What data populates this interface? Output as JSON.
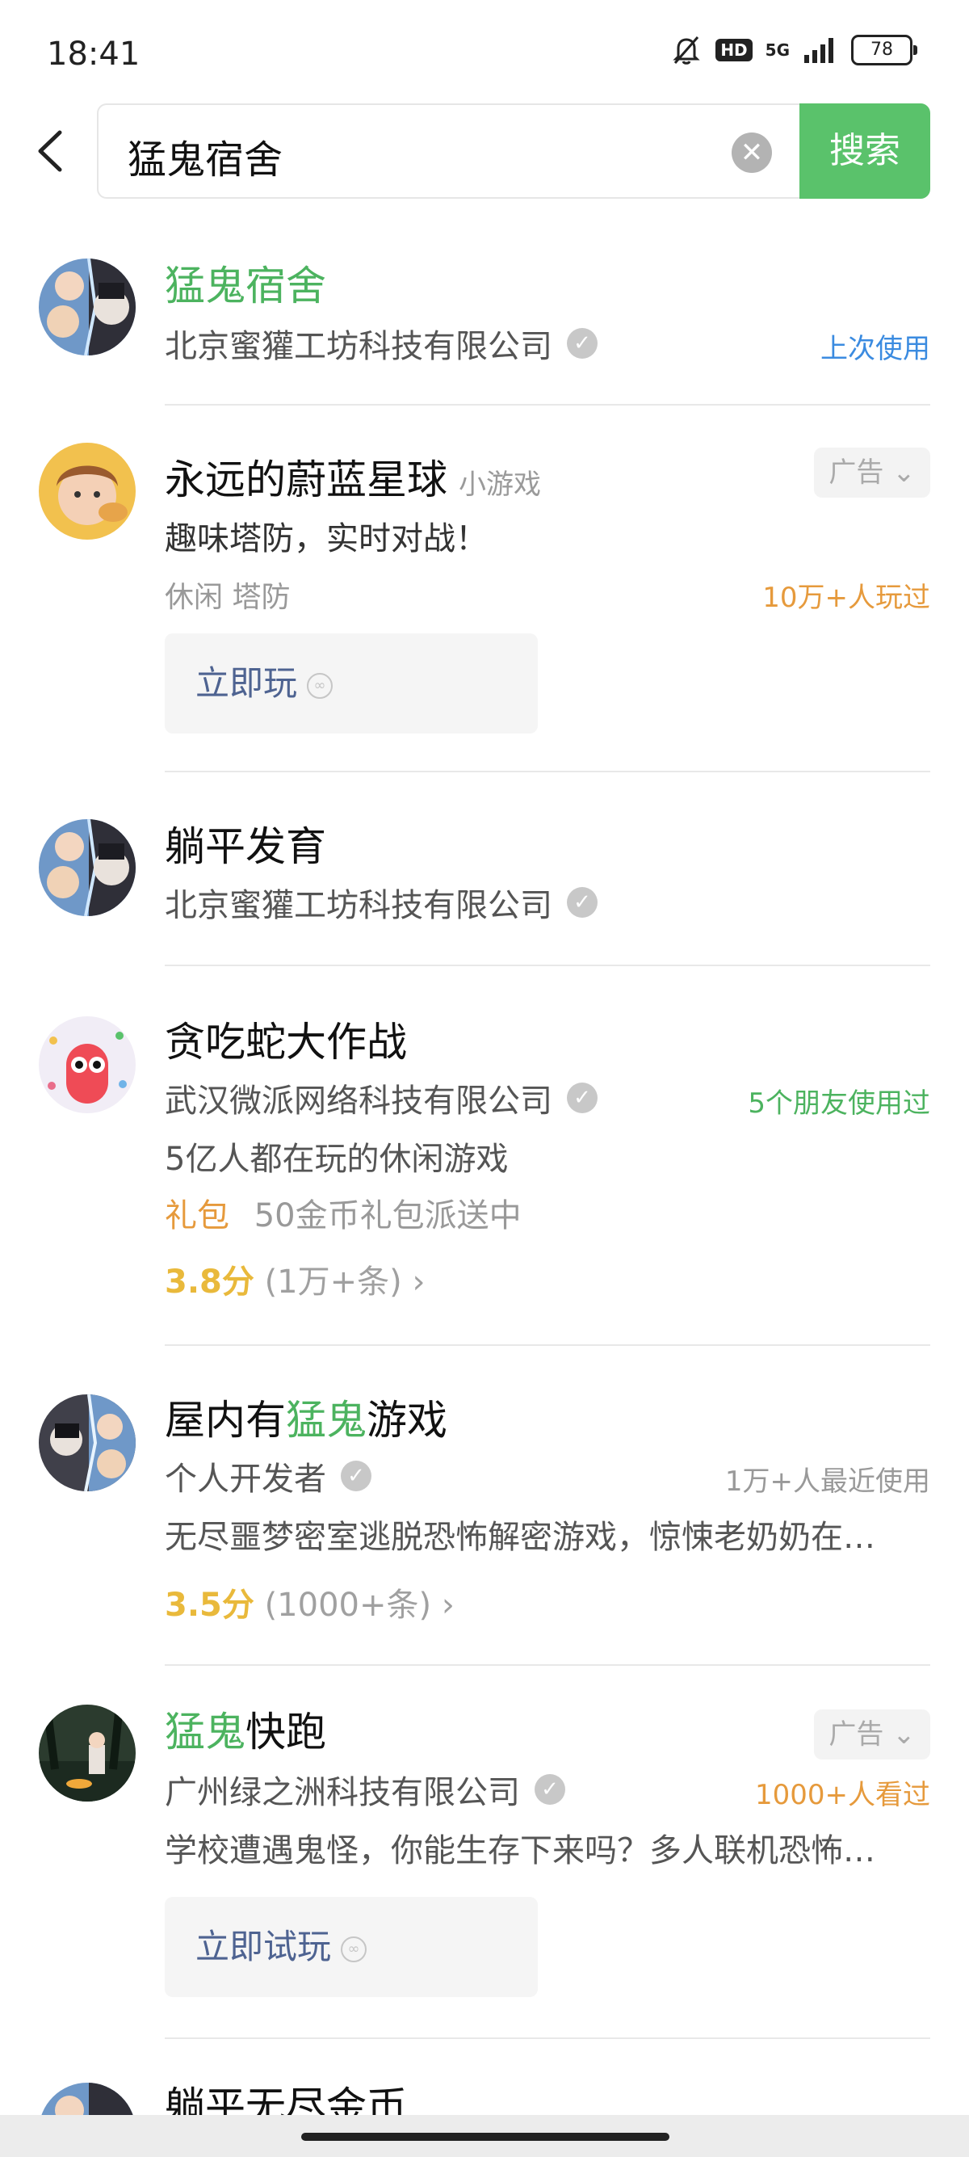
{
  "status": {
    "time": "18:41",
    "hd": "HD",
    "net": "5G",
    "battery": "78"
  },
  "search": {
    "query": "猛鬼宿舍",
    "button": "搜索"
  },
  "results": [
    {
      "title": "猛鬼宿舍",
      "developer": "北京蜜獾工坊科技有限公司",
      "meta": "上次使用"
    },
    {
      "title": "永远的蔚蓝星球",
      "tag": "小游戏",
      "ad": "广告",
      "desc": "趣味塔防，实时对战！",
      "category": "休闲 塔防",
      "meta": "10万+人玩过",
      "action": "立即玩"
    },
    {
      "title": "躺平发育",
      "developer": "北京蜜獾工坊科技有限公司"
    },
    {
      "title": "贪吃蛇大作战",
      "developer": "武汉微派网络科技有限公司",
      "meta": "5个朋友使用过",
      "desc": "5亿人都在玩的休闲游戏",
      "gift_label": "礼包",
      "gift_text": "50金币礼包派送中",
      "score": "3.8分",
      "count": "(1万+条)"
    },
    {
      "title_pre": "屋内有",
      "title_hl": "猛鬼",
      "title_post": "游戏",
      "developer": "个人开发者",
      "meta": "1万+人最近使用",
      "desc": "无尽噩梦密室逃脱恐怖解密游戏，惊悚老奶奶在…",
      "score": "3.5分",
      "count": "(1000+条)"
    },
    {
      "title_hl": "猛鬼",
      "title_post": "快跑",
      "ad": "广告",
      "developer": "广州绿之洲科技有限公司",
      "meta": "1000+人看过",
      "desc": "学校遭遇鬼怪，你能生存下来吗？多人联机恐怖…",
      "action": "立即试玩"
    },
    {
      "title": "躺平无尽金币"
    }
  ],
  "colors": {
    "accent_green": "#5ac26b",
    "highlight_green": "#4cb35f",
    "link_blue": "#3b8be0",
    "orange": "#e69a3c",
    "score_yellow": "#e9b93b"
  }
}
